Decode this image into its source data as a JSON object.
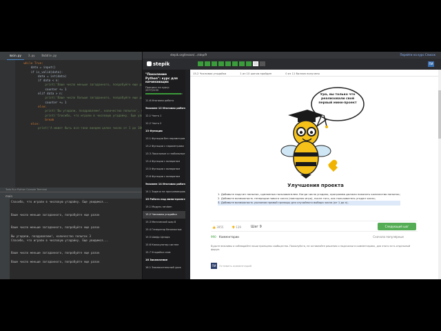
{
  "ide": {
    "tabs": [
      "main.py",
      "3.py",
      "Bubble.py"
    ],
    "code_lines": [
      [
        "    while True:",
        "k"
      ],
      [
        "        data = input()",
        "n"
      ],
      [
        "        if is_valid(data):",
        "n"
      ],
      [
        "            data = int(data)",
        "n"
      ],
      [
        "            if data < n:",
        "n"
      ],
      [
        "                print('Ваше число меньше загаданного, попробуйте еще разок')",
        "s"
      ],
      [
        "                counter += 1",
        "n"
      ],
      [
        "            elif data > n:",
        "n"
      ],
      [
        "                print('Ваше число больше загаданного, попробуйте еще разок')",
        "s"
      ],
      [
        "                counter += 1",
        "n"
      ],
      [
        "            else:",
        "k"
      ],
      [
        "                print('Вы угадали, поздравляем!, количество попыток', counter)",
        "s"
      ],
      [
        "                print('Спасибо, что играли в числовую угадайку. Еще увидимся...')",
        "s"
      ],
      [
        "                break",
        "k"
      ],
      [
        "        else:",
        "k"
      ],
      [
        "            print('А может быть все-таки введем целое число от 1 до 100?')",
        "s"
      ]
    ],
    "run_tabs": "Todo   Run   Python Console   Terminal",
    "console_title": "main",
    "console_lines": [
      "Спасибо, что играли в числовую угадайку. Еще увидимся...",
      "",
      "",
      "Ваше число меньше загаданного, попробуйте еще разок",
      "",
      "",
      "Ваше число меньше загаданного, попробуйте еще разок",
      "",
      "Вы угадали, поздравляем!, количество попыток 3",
      "Спасибо, что играли в числовую угадайку. Еще увидимся...",
      "",
      "",
      "Ваше число меньше загаданного, попробуйте еще разок",
      "",
      "Ваше число меньше загаданного, попробуйте еще разок"
    ]
  },
  "browser": {
    "url": "stepik.org/lesson/.../step/9",
    "extensions": "Перейти на курс  Список",
    "logo": "stepik",
    "steps": [
      "done",
      "done",
      "done",
      "done",
      "done",
      "done",
      "done",
      "done",
      "current",
      "todo"
    ],
    "avatar": "ПИ"
  },
  "sidebar": {
    "course_title": "\"Поколение Python\": курс для начинающих",
    "progress_text": "Прогресс по курсу: 2077/2135",
    "progress": 0.97,
    "items": [
      {
        "label": "11.6 Итоговая работа",
        "type": "lesson"
      },
      {
        "label": "Экзамен 12 Итоговая работа",
        "type": "module"
      },
      {
        "label": "12.1 Часть 1",
        "type": "lesson"
      },
      {
        "label": "12.2 Часть 2",
        "type": "lesson"
      },
      {
        "label": "13 Функции",
        "type": "module"
      },
      {
        "label": "13.1 Функции без параметров",
        "type": "lesson"
      },
      {
        "label": "13.2 Функции с параметрами",
        "type": "lesson"
      },
      {
        "label": "13.3 Локальные и глобальные",
        "type": "lesson"
      },
      {
        "label": "13.4 Функции с возвратом",
        "type": "lesson"
      },
      {
        "label": "13.5 Функции с возвратом",
        "type": "lesson"
      },
      {
        "label": "13.6 Функции с возвратом",
        "type": "lesson"
      },
      {
        "label": "Экзамен 14 Итоговая работа",
        "type": "module"
      },
      {
        "label": "14.1 Задачи на программирование",
        "type": "lesson"
      },
      {
        "label": "15 Работа над мини-проектами",
        "type": "module"
      },
      {
        "label": "15.1 Модуль random",
        "type": "lesson"
      },
      {
        "label": "15.2 Числовая угадайка",
        "type": "active"
      },
      {
        "label": "15.3 Магический шар 8",
        "type": "lesson"
      },
      {
        "label": "15.4 Генератор безопасных",
        "type": "lesson"
      },
      {
        "label": "15.5 Шифр Цезаря",
        "type": "lesson"
      },
      {
        "label": "15.6 Калькулятор систем",
        "type": "lesson"
      },
      {
        "label": "15.7 Угадайка слов",
        "type": "lesson"
      },
      {
        "label": "16 Заключение",
        "type": "module"
      },
      {
        "label": "16.1 Заключительный урок",
        "type": "lesson"
      }
    ]
  },
  "main": {
    "lesson_ref": "15.2 Числовая угадайка",
    "steps_info": "1 из 10 шагов пройден",
    "points_info": "0 из 11 баллов получено",
    "speech_bubble": "Ура, вы только что реализовали свой первый мини-проект",
    "title": "Улучшения проекта",
    "tasks": [
      "1. Добавьте подсчет попыток, сделанных пользователем. Когда число угадано, программа должна показать количество попыток;",
      "2. Добавьте возможность генерации нового числа (повторная игра), после того, как пользователь угадал число;",
      "3. Добавьте возможность указания правой границы для случайного выбора числа (от 1 до n)."
    ],
    "likes": "3955",
    "dislikes": "139",
    "step_label": "Шаг 9",
    "next_button": "Следующий шаг",
    "comments_count": "990",
    "comments_label": "Комментарии",
    "sort_label": "Сначала популярные",
    "comments_note": "Будьте вежливы и соблюдайте наши принципы сообщества. Пожалуйста, не оставляйте решения и подсказки в комментариях, для этого есть отдельный форум.",
    "commenter_avatar": "ПИ",
    "comment_placeholder": "Оставить комментарий"
  }
}
